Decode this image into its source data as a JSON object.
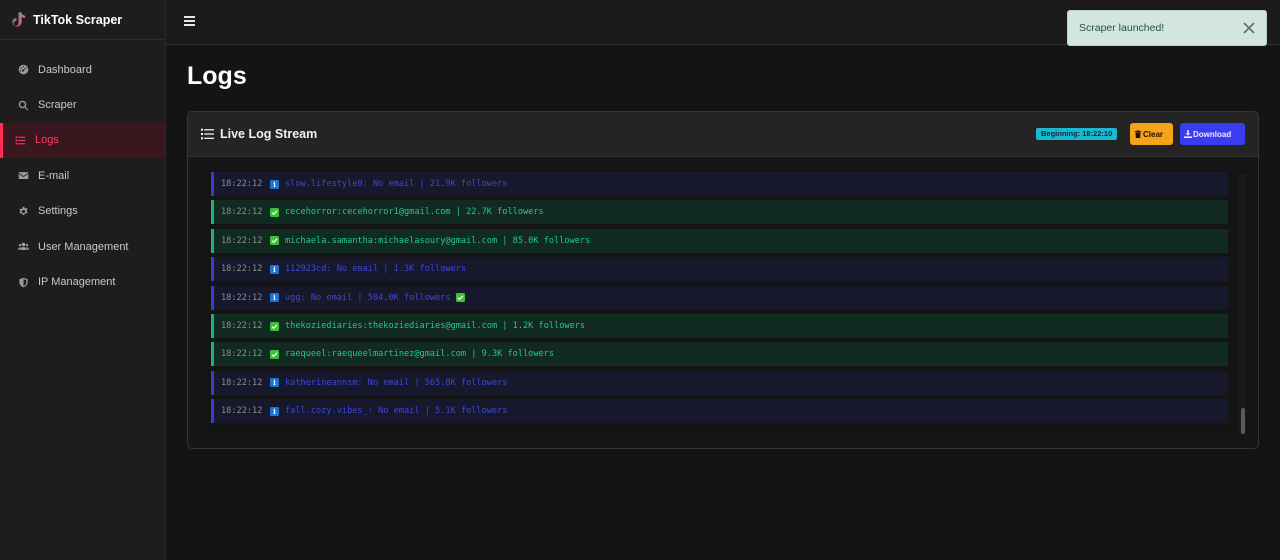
{
  "app": {
    "name": "TikTok Scraper",
    "brand_color": "#ff2d55"
  },
  "sidebar": {
    "items": [
      {
        "label": "Dashboard",
        "icon": "dashboard-gauge-icon",
        "active": false
      },
      {
        "label": "Scraper",
        "icon": "search-icon",
        "active": false
      },
      {
        "label": "Logs",
        "icon": "list-icon",
        "active": true
      },
      {
        "label": "E-mail",
        "icon": "envelope-icon",
        "active": false
      },
      {
        "label": "Settings",
        "icon": "gear-icon",
        "active": false
      },
      {
        "label": "User Management",
        "icon": "users-icon",
        "active": false
      },
      {
        "label": "IP Management",
        "icon": "shield-icon",
        "active": false
      }
    ]
  },
  "toast": {
    "message": "Scraper launched!",
    "type": "success"
  },
  "page": {
    "title": "Logs"
  },
  "card": {
    "title": "Live Log Stream",
    "badge": "Beginning: 18:22:10",
    "clear_label": "Clear",
    "download_label": "Download"
  },
  "logs": [
    {
      "time": "18:22:12",
      "level": "info",
      "message": "slow.lifestyle0: No email | 21.9K followers",
      "trailing_check": false
    },
    {
      "time": "18:22:12",
      "level": "success",
      "message": "cecehorror:cecehorror1@gmail.com | 22.7K followers",
      "trailing_check": false
    },
    {
      "time": "18:22:12",
      "level": "success",
      "message": "michaela.samantha:michaelasoury@gmail.com | 85.0K followers",
      "trailing_check": false
    },
    {
      "time": "18:22:12",
      "level": "info",
      "message": "112923cd: No email | 1.3K followers",
      "trailing_check": false
    },
    {
      "time": "18:22:12",
      "level": "info",
      "message": "ugg: No email | 504.0K followers",
      "trailing_check": true
    },
    {
      "time": "18:22:12",
      "level": "success",
      "message": "thekoziediaries:thekoziediaries@gmail.com | 1.2K followers",
      "trailing_check": false
    },
    {
      "time": "18:22:12",
      "level": "success",
      "message": "raequeel:raequeelmartinez@gmail.com | 9.3K followers",
      "trailing_check": false
    },
    {
      "time": "18:22:12",
      "level": "info",
      "message": "katherineannsm: No email | 565.8K followers",
      "trailing_check": false
    },
    {
      "time": "18:22:12",
      "level": "info",
      "message": "fall.cozy.vibes_: No email | 5.1K followers",
      "trailing_check": false
    }
  ]
}
